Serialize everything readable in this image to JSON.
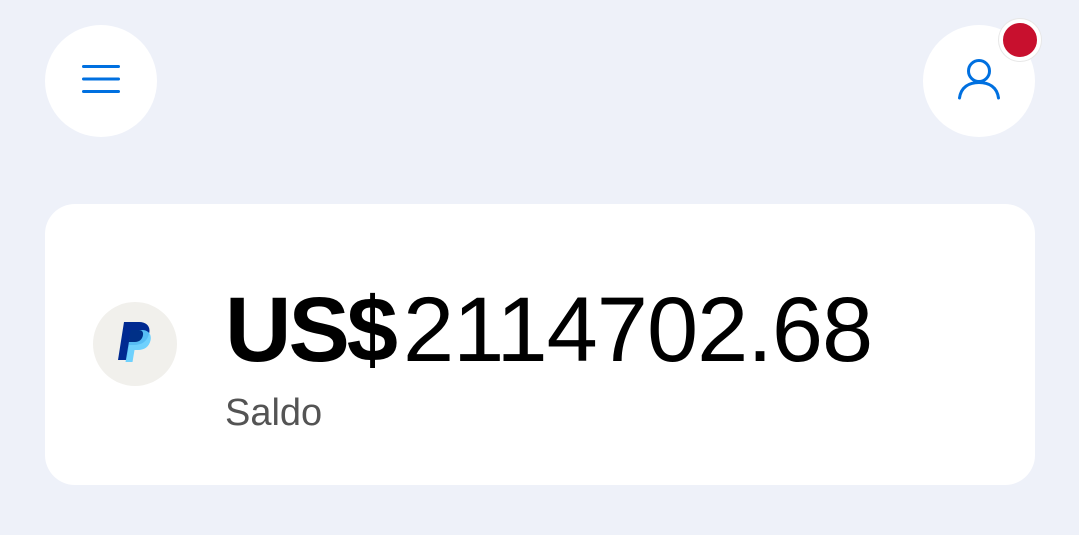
{
  "header": {
    "menu_icon": "hamburger-menu-icon",
    "profile_icon": "user-profile-icon",
    "notification_color": "#c8102e",
    "accent_color": "#0070e0"
  },
  "balance": {
    "currency": "US$",
    "amount": "2114702.68",
    "label": "Saldo",
    "logo": "paypal-logo-icon"
  },
  "colors": {
    "background": "#eef1f9",
    "card": "#ffffff",
    "paypal_dark": "#002991",
    "paypal_light": "#60cdff"
  }
}
